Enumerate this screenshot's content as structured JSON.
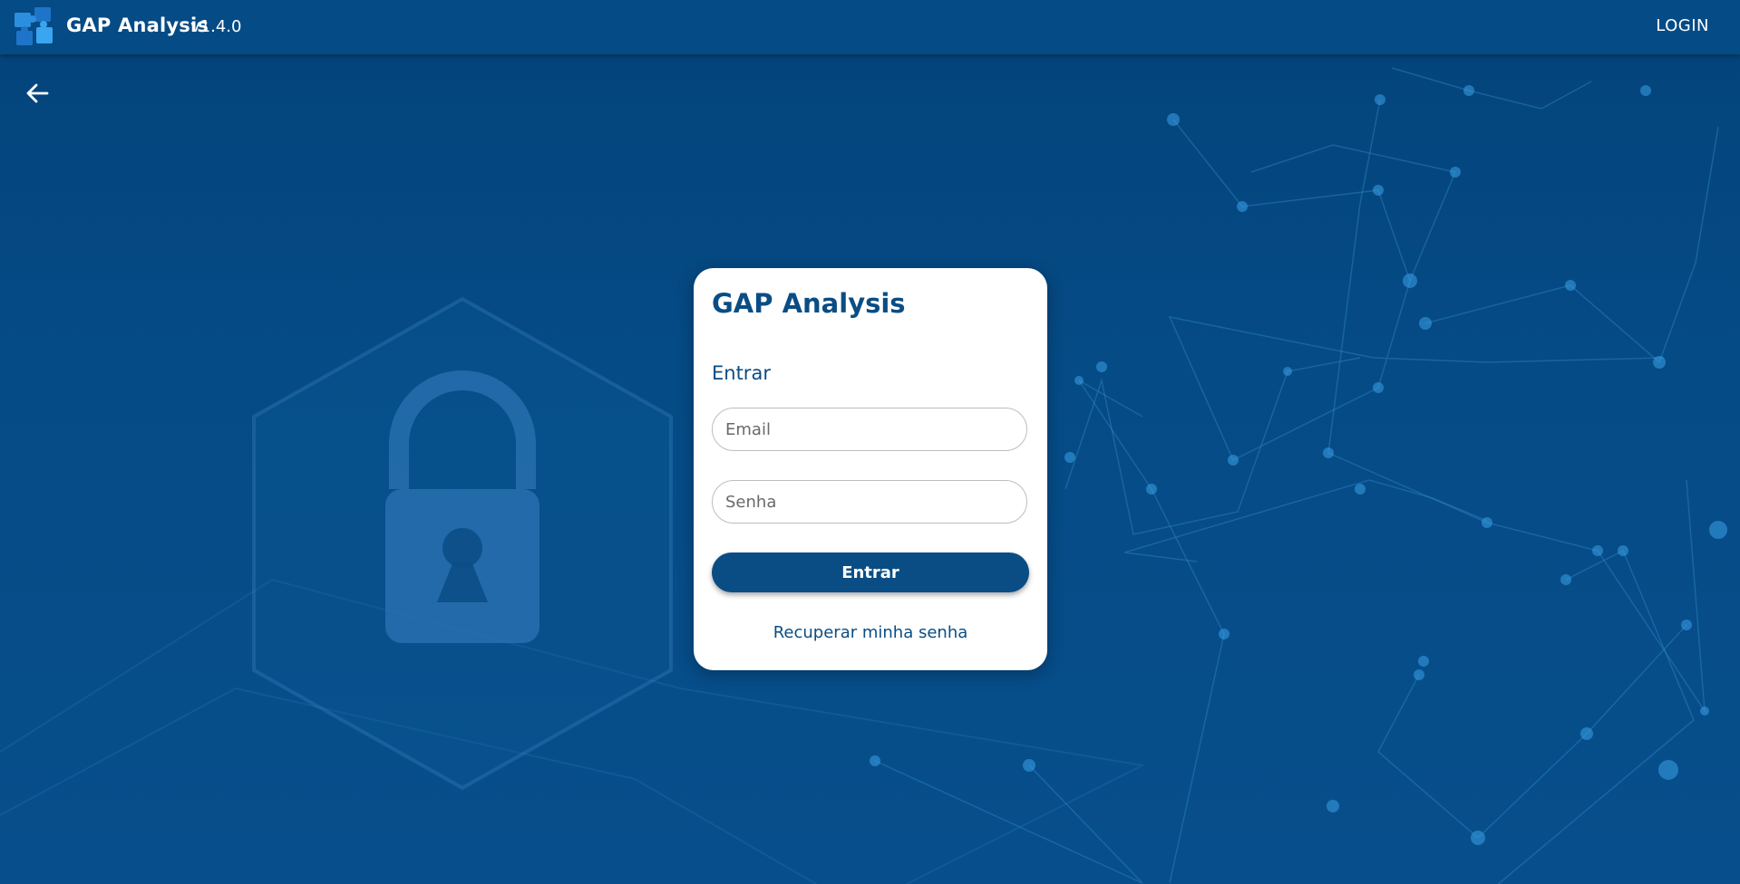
{
  "header": {
    "app_title": "GAP Analysis",
    "version": "v1.4.0",
    "login_label": "LOGIN"
  },
  "login_card": {
    "title": "GAP Analysis",
    "subtitle": "Entrar",
    "email_placeholder": "Email",
    "password_placeholder": "Senha",
    "submit_label": "Entrar",
    "recover_label": "Recuperar minha senha"
  },
  "icons": {
    "logo": "puzzle-logo-icon",
    "back": "arrow-left-icon",
    "illustration": "padlock-icon"
  },
  "colors": {
    "primary": "#0a4d84",
    "header_bg": "#054b86",
    "page_bg": "#04437a",
    "card_bg": "#ffffff"
  }
}
